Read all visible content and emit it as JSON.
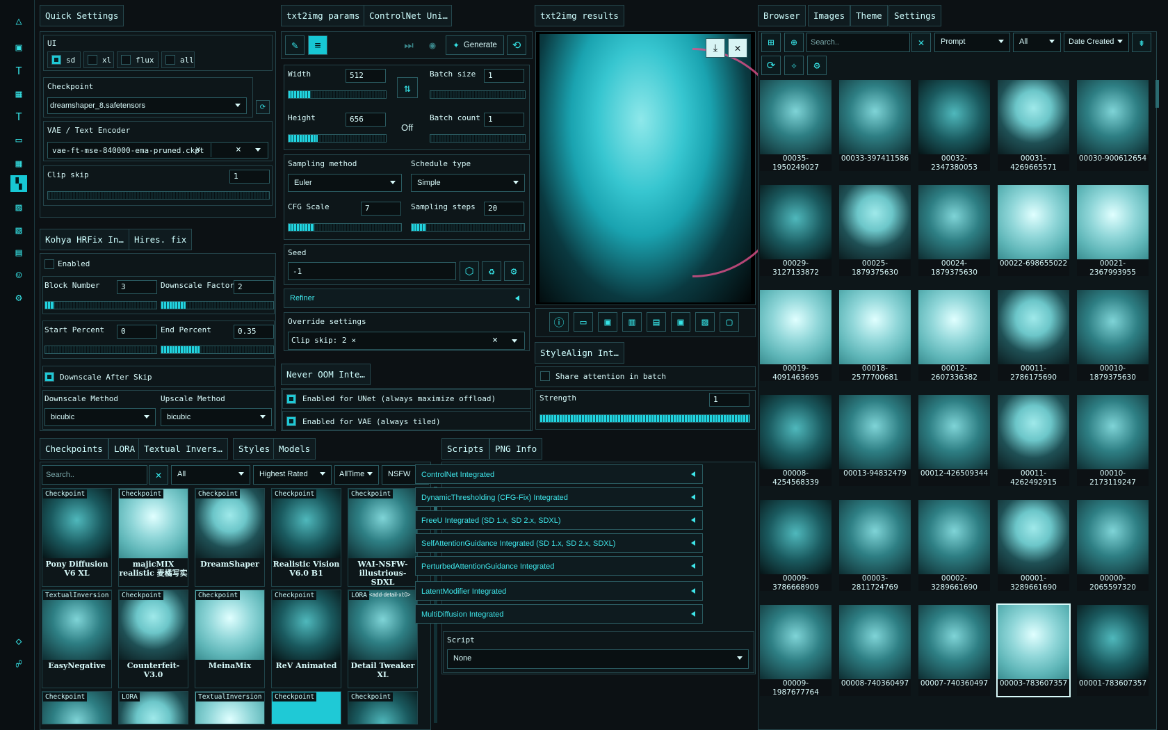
{
  "colors": {
    "accent": "#17c7d4",
    "bg": "#0c1114",
    "text": "#d8fafa",
    "panel_border": "#24444a"
  },
  "sidebar": {
    "icons": [
      "triangle-logo-icon",
      "layout-icon",
      "text-icon",
      "chip-icon",
      "text-box-icon",
      "monitor-icon",
      "chip2-icon",
      "grid-icon",
      "image-icon",
      "image-edit-icon",
      "calendar-image-icon",
      "smile-icon",
      "gear-icon",
      "diamond-icon",
      "people-icon"
    ]
  },
  "quick_settings": {
    "tab": "Quick Settings",
    "ui_label": "UI",
    "ui_options": [
      "sd",
      "xl",
      "flux",
      "all"
    ],
    "checkpoint_label": "Checkpoint",
    "checkpoint_value": "dreamshaper_8.safetensors",
    "vae_label": "VAE / Text Encoder",
    "vae_value": "vae-ft-mse-840000-ema-pruned.ckpt",
    "clip_skip_label": "Clip skip",
    "clip_skip_value": "1"
  },
  "hires": {
    "tabs": [
      "Kohya HRFix In…",
      "Hires. fix"
    ],
    "enabled_label": "Enabled",
    "block_number_label": "Block Number",
    "block_number_value": "3",
    "block_number_fill": 0.08,
    "downscale_factor_label": "Downscale Factor",
    "downscale_factor_value": "2",
    "downscale_factor_fill": 0.22,
    "start_percent_label": "Start Percent",
    "start_percent_value": "0",
    "start_percent_fill": 0.0,
    "end_percent_label": "End Percent",
    "end_percent_value": "0.35",
    "end_percent_fill": 0.35,
    "downscale_after_skip_label": "Downscale After Skip",
    "downscale_method_label": "Downscale Method",
    "downscale_method_value": "bicubic",
    "upscale_method_label": "Upscale Method",
    "upscale_method_value": "bicubic"
  },
  "params": {
    "tabs": [
      "txt2img params",
      "ControlNet Uni…"
    ],
    "generate_label": "Generate",
    "width_label": "Width",
    "width_value": "512",
    "width_fill": 0.23,
    "height_label": "Height",
    "height_value": "656",
    "height_fill": 0.3,
    "swap_label": "Off",
    "batch_size_label": "Batch size",
    "batch_size_value": "1",
    "batch_count_label": "Batch count",
    "batch_count_value": "1",
    "sampling_method_label": "Sampling method",
    "sampling_method_value": "Euler",
    "schedule_type_label": "Schedule type",
    "schedule_type_value": "Simple",
    "cfg_label": "CFG Scale",
    "cfg_value": "7",
    "cfg_fill": 0.23,
    "steps_label": "Sampling steps",
    "steps_value": "20",
    "steps_fill": 0.13,
    "seed_label": "Seed",
    "seed_value": "-1",
    "refiner_label": "Refiner",
    "override_label": "Override settings",
    "override_chip": "Clip skip: 2"
  },
  "never_oom": {
    "tab": "Never OOM Inte…",
    "unet_label": "Enabled for UNet (always maximize offload)",
    "vae_label": "Enabled for VAE (always tiled)"
  },
  "results": {
    "tab": "txt2img results",
    "stylealign_tab": "StyleAlign Int…",
    "share_attention_label": "Share attention in batch",
    "strength_label": "Strength",
    "strength_value": "1",
    "strength_fill": 1.0
  },
  "networks": {
    "tabs": [
      "Checkpoints",
      "LORA",
      "Textual Invers…",
      "Styles",
      "Models"
    ],
    "search_placeholder": "Search..",
    "filter_all": "All",
    "filter_sort": "Highest Rated",
    "filter_time": "AllTime",
    "filter_nsfw": "NSFW",
    "cards": [
      {
        "badge": "Checkpoint",
        "name": "Pony Diffusion V6 XL",
        "img": "pimg4"
      },
      {
        "badge": "Checkpoint",
        "name": "majicMIX realistic 麦橘写实",
        "img": "pimg2"
      },
      {
        "badge": "Checkpoint",
        "name": "DreamShaper",
        "img": "pimg1"
      },
      {
        "badge": "Checkpoint",
        "name": "Realistic Vision V6.0 B1",
        "img": "pimg4"
      },
      {
        "badge": "Checkpoint",
        "name": "WAI-NSFW-illustrious-SDXL",
        "img": "pimg3"
      },
      {
        "badge": "TextualInversion",
        "name": "EasyNegative",
        "img": "pimg3"
      },
      {
        "badge": "Checkpoint",
        "name": "Counterfeit-V3.0",
        "img": "pimg1"
      },
      {
        "badge": "Checkpoint",
        "name": "MeinaMix",
        "img": "pimg2"
      },
      {
        "badge": "Checkpoint",
        "name": "ReV Animated",
        "img": "pimg4"
      },
      {
        "badge": "LORA",
        "name": "Detail Tweaker XL",
        "img": "pimg3",
        "overlay": "<add-detail-xl:0>"
      },
      {
        "badge": "Checkpoint",
        "name": "",
        "img": "pimg3"
      },
      {
        "badge": "LORA",
        "name": "",
        "img": "pimg1"
      },
      {
        "badge": "TextualInversion",
        "name": "",
        "img": "pimg2"
      },
      {
        "badge": "Checkpoint",
        "name": "",
        "img": "pimg0"
      },
      {
        "badge": "Checkpoint",
        "name": "",
        "img": "pimg4"
      }
    ]
  },
  "scripts": {
    "tabs": [
      "Scripts",
      "PNG Info"
    ],
    "accordions": [
      "ControlNet Integrated",
      "DynamicThresholding (CFG-Fix) Integrated",
      "FreeU Integrated (SD 1.x, SD 2.x, SDXL)",
      "SelfAttentionGuidance Integrated (SD 1.x, SD 2.x, SDXL)",
      "PerturbedAttentionGuidance Integrated",
      "LatentModifier Integrated",
      "MultiDiffusion Integrated"
    ],
    "script_label": "Script",
    "script_value": "None"
  },
  "browser": {
    "tabs": [
      "Browser",
      "Images",
      "Theme",
      "Settings"
    ],
    "search_placeholder": "Search..",
    "filter_field": "Prompt",
    "filter_scope": "All",
    "sort": "Date Created",
    "thumbs": [
      {
        "cap": "00035-1950249027",
        "img": "pimg3"
      },
      {
        "cap": "00033-397411586",
        "img": "pimg3"
      },
      {
        "cap": "00032-2347380053",
        "img": "pimg4"
      },
      {
        "cap": "00031-4269665571",
        "img": "pimg1"
      },
      {
        "cap": "00030-900612654",
        "img": "pimg3"
      },
      {
        "cap": "00029-3127133872",
        "img": "pimg4"
      },
      {
        "cap": "00025-1879375630",
        "img": "pimg1"
      },
      {
        "cap": "00024-1879375630",
        "img": "pimg3"
      },
      {
        "cap": "00022-698655022",
        "img": "pimg2"
      },
      {
        "cap": "00021-2367993955",
        "img": "pimg2"
      },
      {
        "cap": "00019-4091463695",
        "img": "pimg2"
      },
      {
        "cap": "00018-2577700681",
        "img": "pimg2"
      },
      {
        "cap": "00012-2607336382",
        "img": "pimg2"
      },
      {
        "cap": "00011-2786175690",
        "img": "pimg1"
      },
      {
        "cap": "00010-1879375630",
        "img": "pimg3"
      },
      {
        "cap": "00008-4254568339",
        "img": "pimg4"
      },
      {
        "cap": "00013-94832479",
        "img": "pimg3"
      },
      {
        "cap": "00012-426509344",
        "img": "pimg3"
      },
      {
        "cap": "00011-4262492915",
        "img": "pimg1"
      },
      {
        "cap": "00010-2173119247",
        "img": "pimg3"
      },
      {
        "cap": "00009-3786668909",
        "img": "pimg4"
      },
      {
        "cap": "00003-2811724769",
        "img": "pimg3"
      },
      {
        "cap": "00002-3289661690",
        "img": "pimg3"
      },
      {
        "cap": "00001-3289661690",
        "img": "pimg1"
      },
      {
        "cap": "00000-2065597320",
        "img": "pimg3"
      },
      {
        "cap": "00009-1987677764",
        "img": "pimg3"
      },
      {
        "cap": "00008-740360497",
        "img": "pimg3"
      },
      {
        "cap": "00007-740360497",
        "img": "pimg3"
      },
      {
        "cap": "00003-783607357",
        "img": "pimg2"
      },
      {
        "cap": "00001-783607357",
        "img": "pimg4"
      }
    ]
  }
}
